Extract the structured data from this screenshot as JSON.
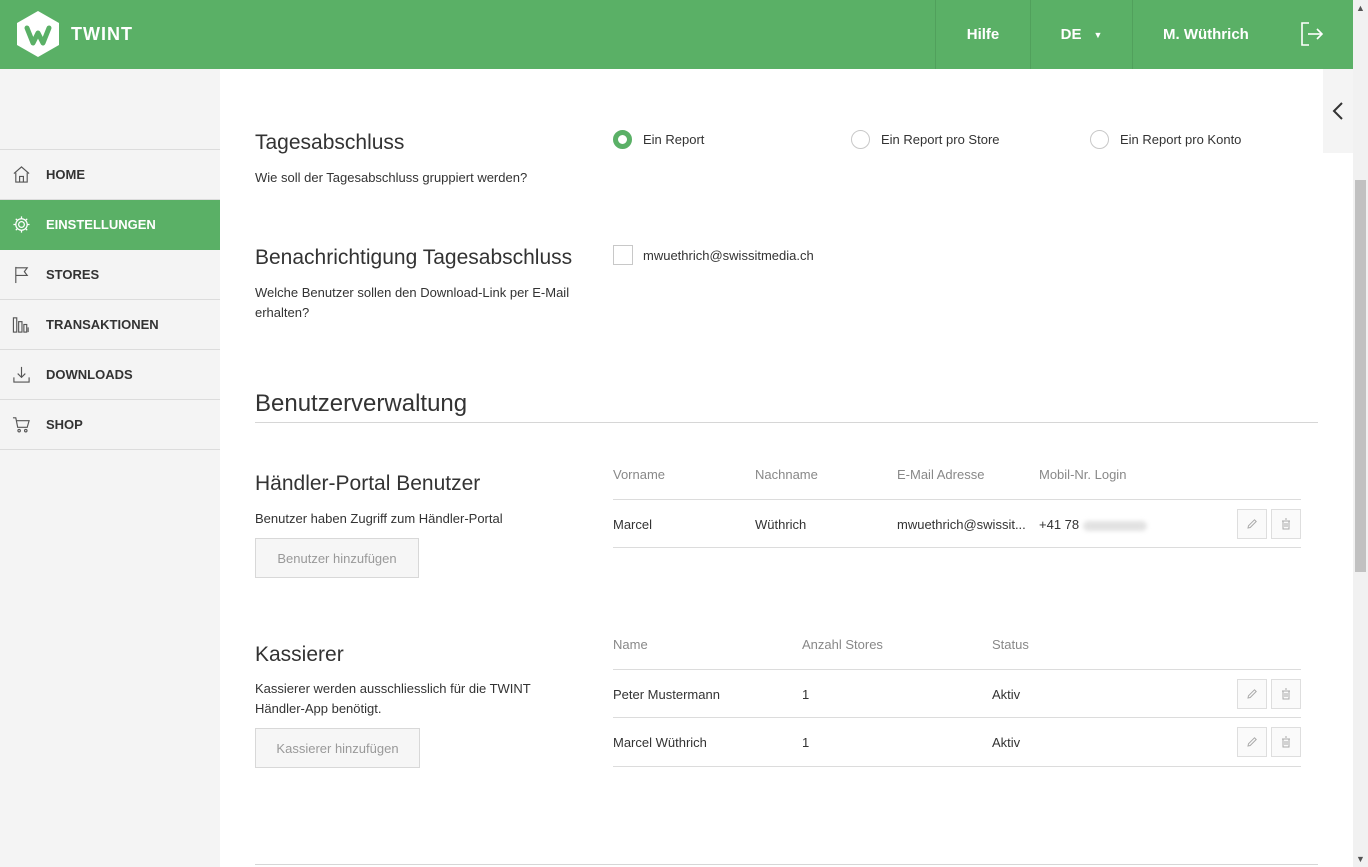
{
  "header": {
    "brand": "TWINT",
    "help": "Hilfe",
    "language": "DE",
    "user": "M. Wüthrich"
  },
  "sidebar": {
    "items": [
      {
        "label": "HOME",
        "icon": "home-icon"
      },
      {
        "label": "EINSTELLUNGEN",
        "icon": "gear-icon",
        "active": true
      },
      {
        "label": "STORES",
        "icon": "flag-icon"
      },
      {
        "label": "TRANSAKTIONEN",
        "icon": "bar-chart-icon"
      },
      {
        "label": "DOWNLOADS",
        "icon": "download-icon"
      },
      {
        "label": "SHOP",
        "icon": "cart-icon"
      }
    ]
  },
  "tagesabschluss": {
    "title": "Tagesabschluss",
    "description": "Wie soll der Tagesabschluss gruppiert werden?",
    "options": [
      "Ein Report",
      "Ein Report pro Store",
      "Ein Report pro Konto"
    ],
    "selected": "Ein Report"
  },
  "benachrichtigung": {
    "title": "Benachrichtigung Tagesabschluss",
    "description_line1": "Welche Benutzer sollen den Download-Link per E-Mail",
    "description_line2": "erhalten?",
    "email": "mwuethrich@swissitmedia.ch",
    "checked": false
  },
  "benutzerverwaltung": {
    "title": "Benutzerverwaltung"
  },
  "haendler_portal": {
    "title": "Händler-Portal Benutzer",
    "description": "Benutzer haben Zugriff zum Händler-Portal",
    "add_button": "Benutzer hinzufügen",
    "columns": [
      "Vorname",
      "Nachname",
      "E-Mail Adresse",
      "Mobil-Nr. Login"
    ],
    "rows": [
      {
        "vorname": "Marcel",
        "nachname": "Wüthrich",
        "email": "mwuethrich@swissit...",
        "mobile": "+41 78"
      }
    ]
  },
  "kassierer": {
    "title": "Kassierer",
    "description_line1": "Kassierer werden ausschliesslich für die TWINT",
    "description_line2": "Händler-App benötigt.",
    "add_button": "Kassierer hinzufügen",
    "columns": [
      "Name",
      "Anzahl Stores",
      "Status"
    ],
    "rows": [
      {
        "name": "Peter Mustermann",
        "stores": "1",
        "status": "Aktiv"
      },
      {
        "name": "Marcel Wüthrich",
        "stores": "1",
        "status": "Aktiv"
      }
    ]
  },
  "colors": {
    "brand_green": "#5ab066",
    "sidebar_bg": "#f4f4f4"
  }
}
